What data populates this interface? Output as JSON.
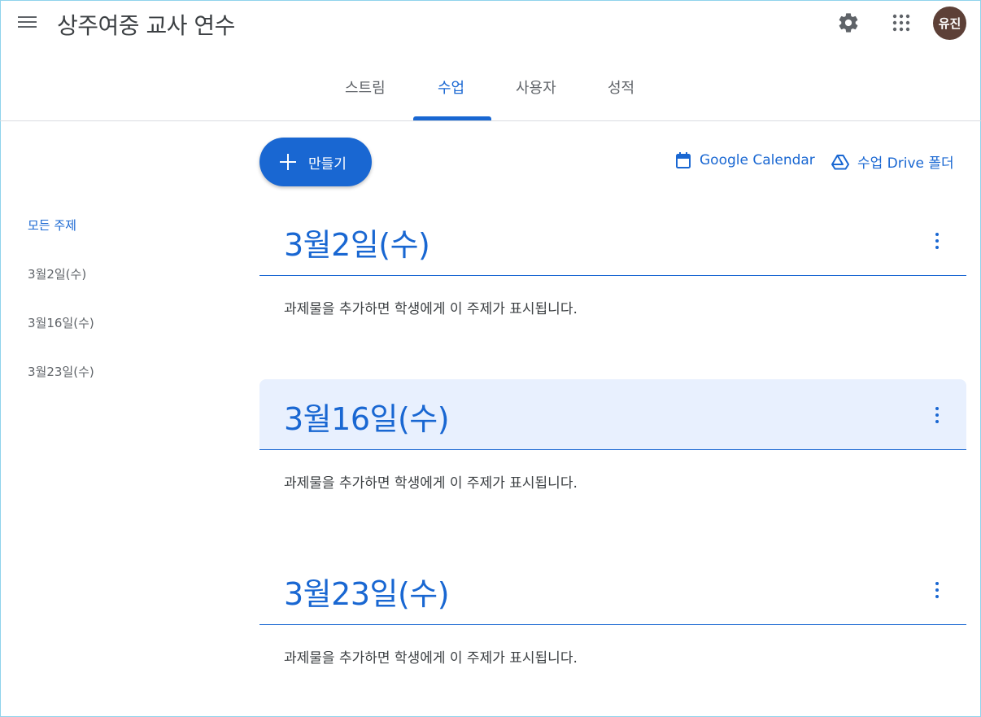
{
  "header": {
    "class_title": "상주여중 교사 연수",
    "avatar_text": "유진",
    "icons": [
      "menu-icon",
      "gear-icon",
      "apps-grid-icon"
    ]
  },
  "tabs": [
    {
      "label": "스트림",
      "active": false
    },
    {
      "label": "수업",
      "active": true
    },
    {
      "label": "사용자",
      "active": false
    },
    {
      "label": "성적",
      "active": false
    }
  ],
  "toolbar": {
    "create_label": "만들기",
    "calendar_label": "Google Calendar",
    "drive_label": "수업 Drive 폴더"
  },
  "sidebar": {
    "items": [
      {
        "label": "모든 주제",
        "active": true
      },
      {
        "label": "3월2일(수)",
        "active": false
      },
      {
        "label": "3월16일(수)",
        "active": false
      },
      {
        "label": "3월23일(수)",
        "active": false
      }
    ]
  },
  "topics": [
    {
      "title": "3월2일(수)",
      "empty_text": "과제물을 추가하면 학생에게 이 주제가 표시됩니다.",
      "highlighted": false
    },
    {
      "title": "3월16일(수)",
      "empty_text": "과제물을 추가하면 학생에게 이 주제가 표시됩니다.",
      "highlighted": true
    },
    {
      "title": "3월23일(수)",
      "empty_text": "과제물을 추가하면 학생에게 이 주제가 표시됩니다.",
      "highlighted": false
    }
  ],
  "colors": {
    "accent": "#1967d2",
    "highlight_bg": "#e8f0fe",
    "avatar_bg": "#5d4037",
    "text": "#3c4043"
  }
}
